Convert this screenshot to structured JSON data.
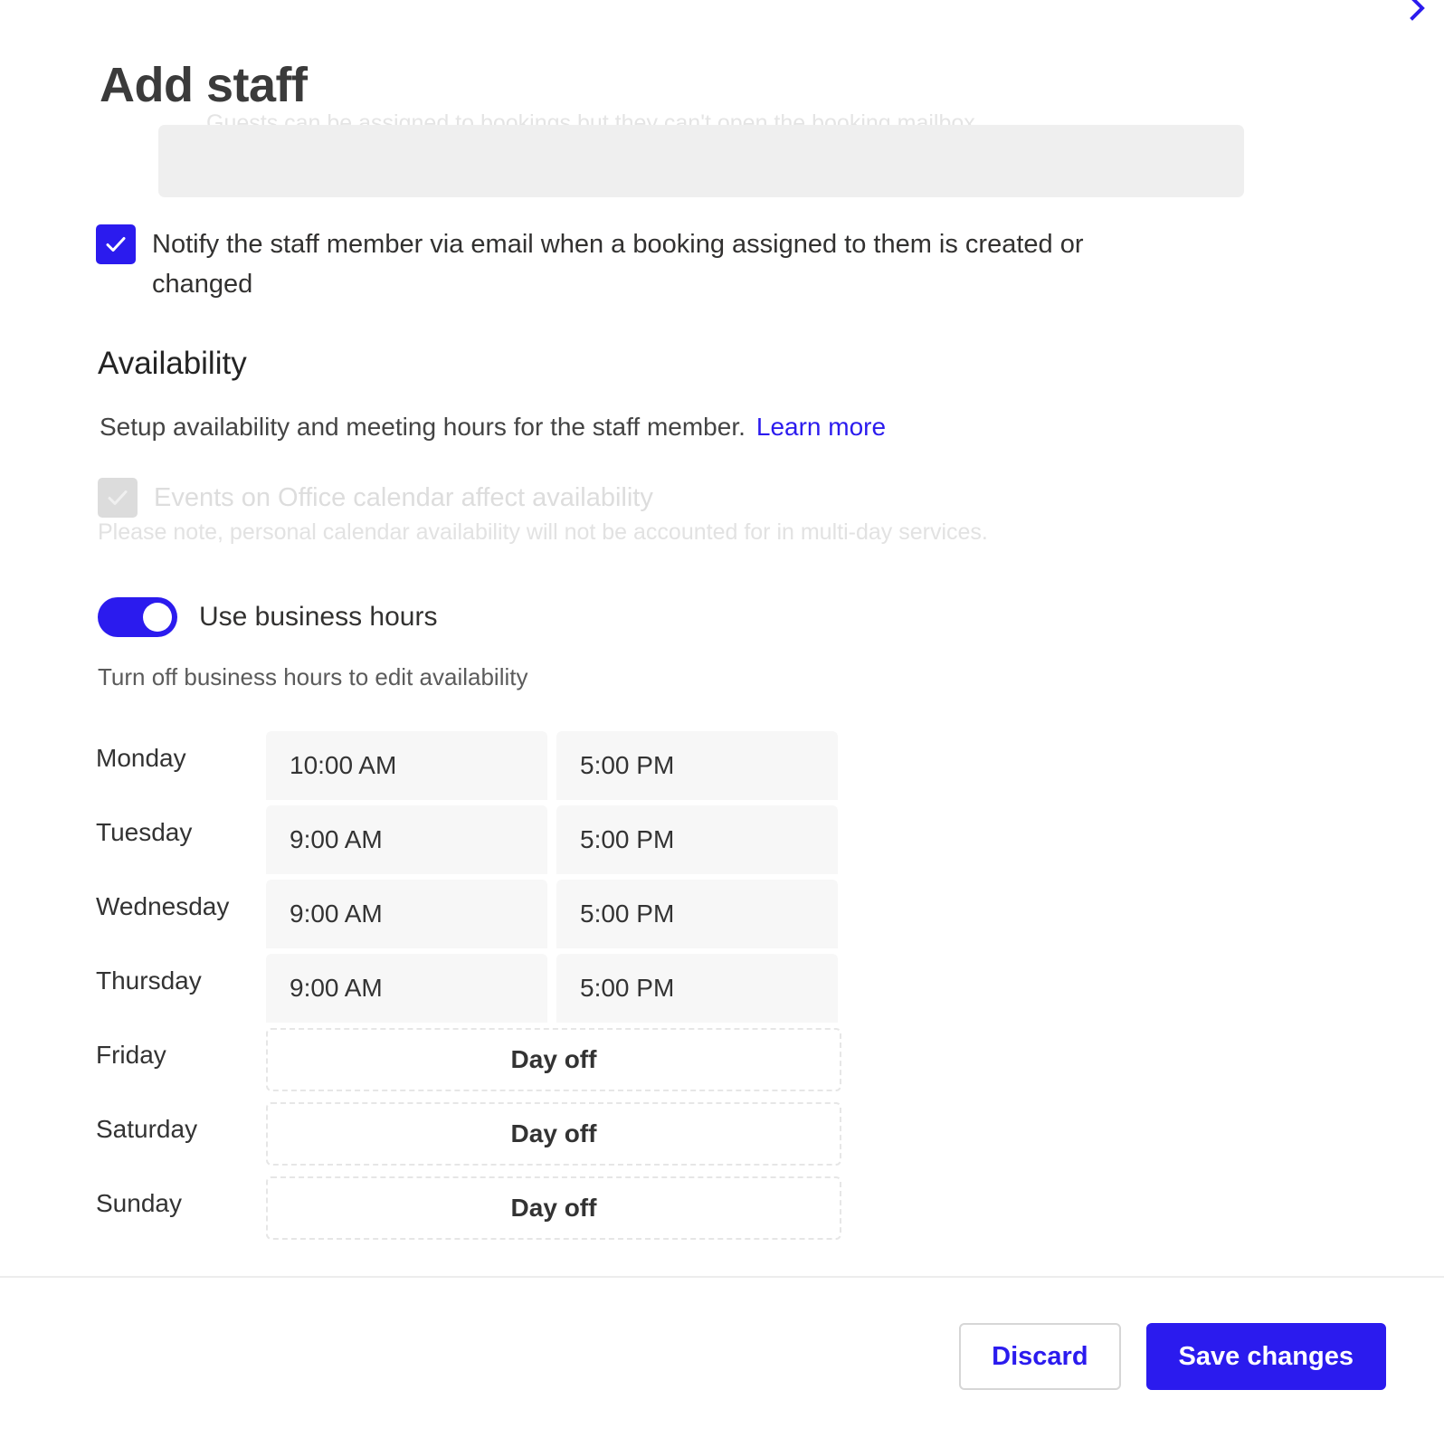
{
  "header": {
    "title": "Add staff",
    "close_icon": "close-chevron-icon"
  },
  "scrolled_text": {
    "ghost_line": "Guests can be assigned to bookings but they can't open the booking mailbox."
  },
  "notify": {
    "checked": true,
    "label": "Notify the staff member via email when a booking assigned to them is created or changed"
  },
  "availability": {
    "heading": "Availability",
    "description": "Setup availability and meeting hours for the staff member.",
    "learn_more": "Learn more",
    "office_calendar": {
      "checked": true,
      "disabled": true,
      "label": "Events on Office calendar affect availability",
      "note": "Please note, personal calendar availability will not be accounted for in multi-day services."
    },
    "business_hours": {
      "enabled": true,
      "label": "Use business hours",
      "hint": "Turn off business hours to edit availability"
    },
    "day_off_label": "Day off",
    "schedule": [
      {
        "day": "Monday",
        "off": false,
        "start": "10:00 AM",
        "end": "5:00 PM"
      },
      {
        "day": "Tuesday",
        "off": false,
        "start": "9:00 AM",
        "end": "5:00 PM"
      },
      {
        "day": "Wednesday",
        "off": false,
        "start": "9:00 AM",
        "end": "5:00 PM"
      },
      {
        "day": "Thursday",
        "off": false,
        "start": "9:00 AM",
        "end": "5:00 PM"
      },
      {
        "day": "Friday",
        "off": true,
        "start": "Day off",
        "end": ""
      },
      {
        "day": "Saturday",
        "off": true,
        "start": "Day off",
        "end": ""
      },
      {
        "day": "Sunday",
        "off": true,
        "start": "Day off",
        "end": ""
      }
    ]
  },
  "footer": {
    "discard_label": "Discard",
    "save_label": "Save changes"
  },
  "colors": {
    "accent": "#2b1bee",
    "text": "#323130",
    "muted": "#5b5b5b",
    "disabled": "#dddddd",
    "field_bg": "#f7f7f7"
  }
}
